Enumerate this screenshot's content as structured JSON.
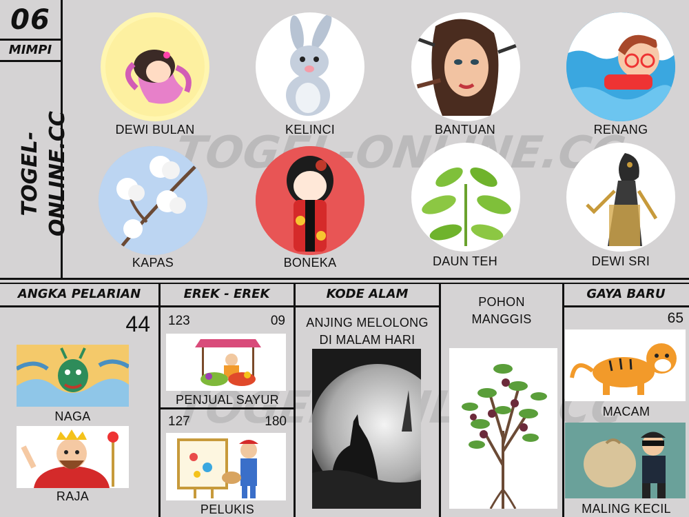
{
  "header": {
    "number": "06",
    "label": "MIMPI",
    "site": "TOGEL-ONLINE.CC"
  },
  "watermark": {
    "text": "TOGEL-ONLINE.CC"
  },
  "dreams": [
    {
      "label": "DEWI BULAN",
      "icon": "moon-goddess-icon"
    },
    {
      "label": "KELINCI",
      "icon": "rabbit-icon"
    },
    {
      "label": "BANTUAN",
      "icon": "makeup-woman-icon"
    },
    {
      "label": "RENANG",
      "icon": "swimming-boy-icon"
    },
    {
      "label": "KAPAS",
      "icon": "cotton-plant-icon"
    },
    {
      "label": "BONEKA",
      "icon": "kokeshi-doll-icon"
    },
    {
      "label": "DAUN TEH",
      "icon": "tea-leaves-icon"
    },
    {
      "label": "DEWI SRI",
      "icon": "wayang-puppet-icon"
    }
  ],
  "sections": {
    "angka_pelarian": {
      "title": "ANGKA PELARIAN",
      "number": "44",
      "items": [
        {
          "label": "NAGA",
          "icon": "dragon-icon"
        },
        {
          "label": "RAJA",
          "icon": "king-icon"
        }
      ]
    },
    "erek_erek": {
      "title": "EREK - EREK",
      "items": [
        {
          "left": "123",
          "right": "09",
          "label": "PENJUAL SAYUR",
          "icon": "vegetable-seller-icon"
        },
        {
          "left": "127",
          "right": "180",
          "label": "PELUKIS",
          "icon": "painter-icon"
        }
      ]
    },
    "kode_alam": {
      "title": "KODE ALAM",
      "label_line1": "ANJING MELOLONG",
      "label_line2": "DI MALAM HARI",
      "icon": "howling-wolf-icon"
    },
    "pohon": {
      "label_line1": "POHON",
      "label_line2": "MANGGIS",
      "icon": "mangosteen-tree-icon"
    },
    "gaya_baru": {
      "title": "GAYA BARU",
      "number": "65",
      "items": [
        {
          "label": "MACAM",
          "icon": "tiger-icon"
        },
        {
          "label": "MALING KECIL",
          "icon": "thief-icon"
        }
      ]
    }
  },
  "colors": {
    "background": "#d5d3d4",
    "border": "#111111",
    "moon_bg": "#fff6b0",
    "swim_bg": "#3aa7e0",
    "cotton_bg": "#a8c8ee",
    "doll_bg": "#e85555"
  }
}
